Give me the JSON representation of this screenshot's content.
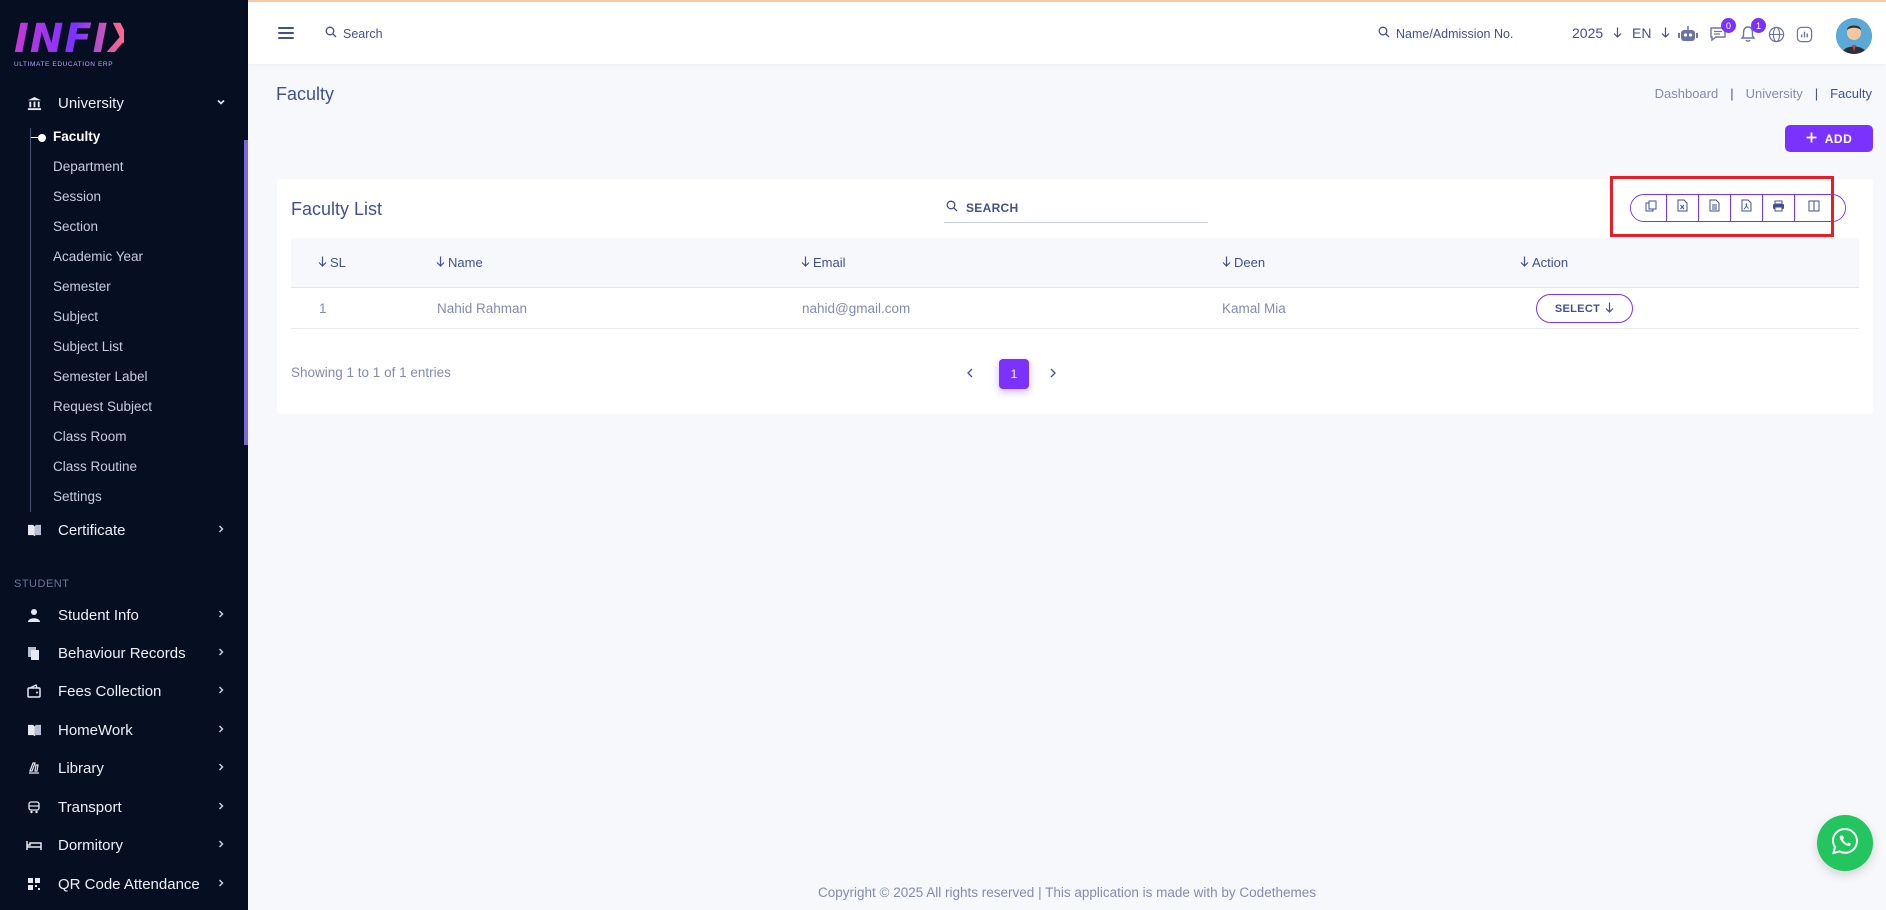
{
  "brand": {
    "logo_text": "INFIX",
    "logo_subtitle": "ULTIMATE EDUCATION ERP"
  },
  "sidebar": {
    "university": {
      "label": "University",
      "icon": "bank-icon",
      "expanded": true
    },
    "sub_items": [
      "Faculty",
      "Department",
      "Session",
      "Section",
      "Academic Year",
      "Semester",
      "Subject",
      "Subject List",
      "Semester Label",
      "Request Subject",
      "Class Room",
      "Class Routine",
      "Settings"
    ],
    "active_item": "Faculty",
    "certificate": {
      "label": "Certificate",
      "icon": "book-icon"
    },
    "student_section_label": "STUDENT",
    "student_items": [
      {
        "label": "Student Info",
        "icon": "user-icon"
      },
      {
        "label": "Behaviour Records",
        "icon": "files-icon"
      },
      {
        "label": "Fees Collection",
        "icon": "wallet-icon"
      },
      {
        "label": "HomeWork",
        "icon": "book-icon"
      },
      {
        "label": "Library",
        "icon": "library-icon"
      },
      {
        "label": "Transport",
        "icon": "bus-icon"
      },
      {
        "label": "Dormitory",
        "icon": "bed-icon"
      },
      {
        "label": "QR Code Attendance",
        "icon": "qr-icon"
      }
    ]
  },
  "topbar": {
    "search_label": "Search",
    "admission_search_label": "Name/Admission No.",
    "year": "2025",
    "language": "EN",
    "chat_count": "0",
    "notification_count": "1"
  },
  "page": {
    "title": "Faculty",
    "breadcrumb": [
      "Dashboard",
      "University",
      "Faculty"
    ],
    "add_label": "ADD"
  },
  "card": {
    "title": "Faculty List",
    "search_placeholder": "SEARCH",
    "export_buttons": [
      "copy-icon",
      "excel-icon",
      "csv-icon",
      "pdf-icon",
      "print-icon",
      "columns-icon"
    ],
    "columns": [
      "SL",
      "Name",
      "Email",
      "Deen",
      "Action"
    ],
    "rows": [
      {
        "sl": "1",
        "name": "Nahid Rahman",
        "email": "nahid@gmail.com",
        "deen": "Kamal Mia",
        "action": "SELECT"
      }
    ],
    "info": "Showing 1 to 1 of 1 entries",
    "current_page": "1"
  },
  "footer": {
    "text": "Copyright © 2025 All rights reserved | This application is made with by Codethemes"
  },
  "colors": {
    "accent": "#7c32ff",
    "sidebar_bg": "#060e22",
    "text": "#415094",
    "muted": "#828bb2",
    "highlight": "#ea1c24",
    "whatsapp": "#22c55e"
  }
}
